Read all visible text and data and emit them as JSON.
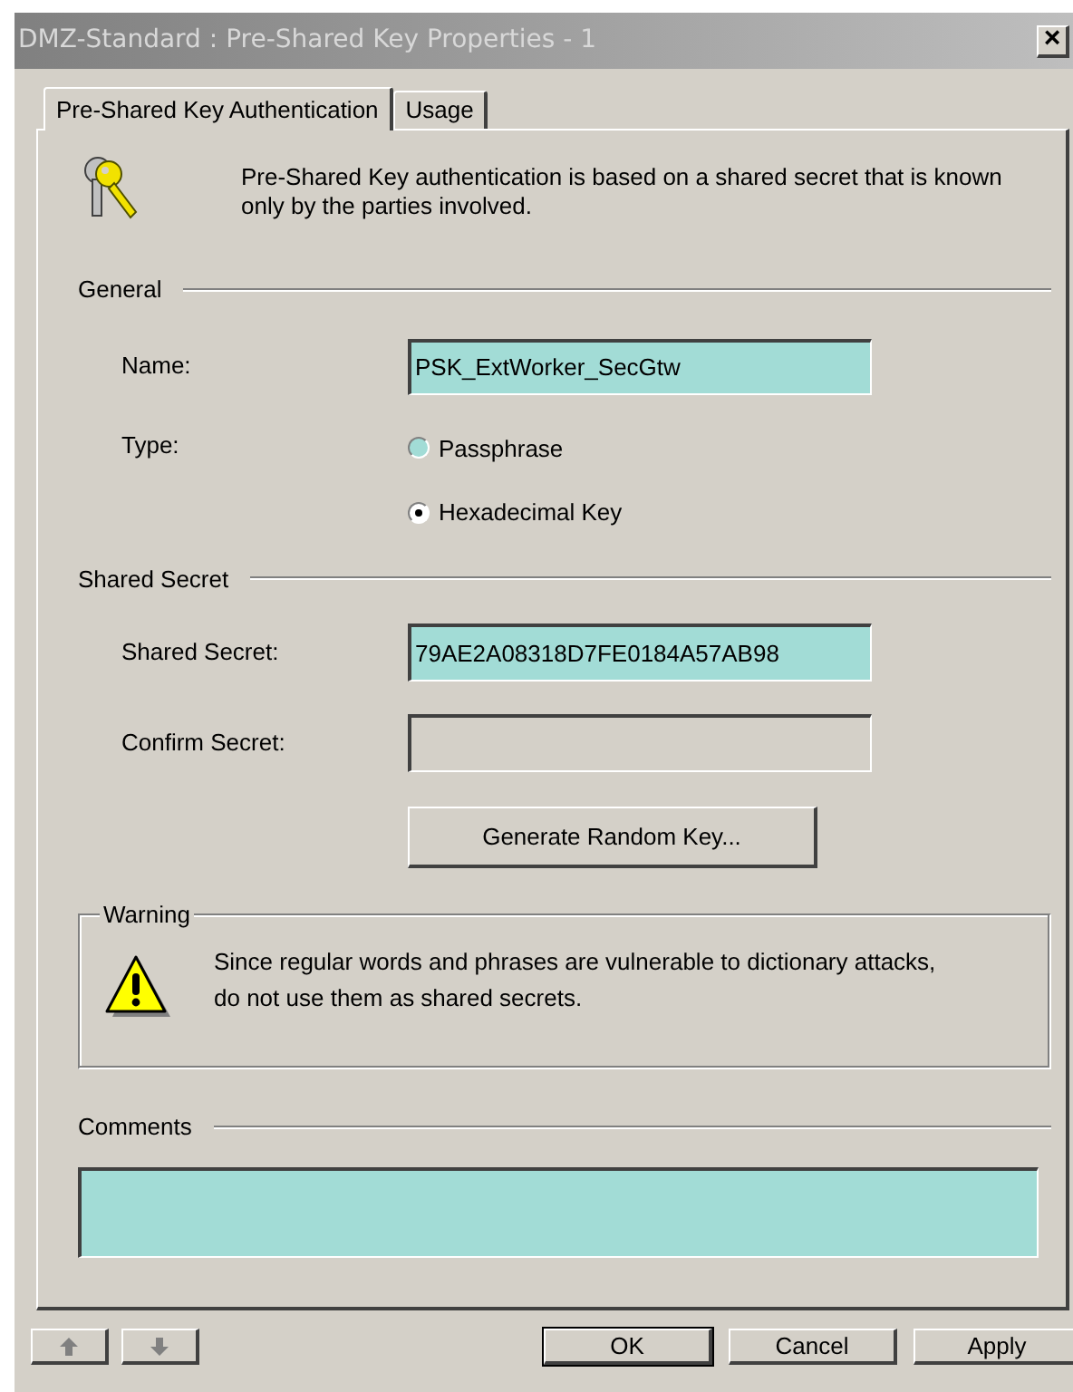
{
  "window": {
    "title": "DMZ-Standard : Pre-Shared Key Properties - 1",
    "close": "×"
  },
  "tabs": [
    {
      "label": "Pre-Shared Key Authentication",
      "selected": true
    },
    {
      "label": "Usage",
      "selected": false
    }
  ],
  "description": "Pre-Shared Key authentication is based on a shared secret that is known only by the parties involved.",
  "general": {
    "heading": "General",
    "name_label": "Name:",
    "name_value": "PSK_ExtWorker_SecGtw",
    "type_label": "Type:",
    "type_options": [
      {
        "label": "Passphrase",
        "selected": false
      },
      {
        "label": "Hexadecimal Key",
        "selected": true
      }
    ]
  },
  "shared_secret": {
    "heading": "Shared Secret",
    "secret_label": "Shared Secret:",
    "secret_value": "79AE2A08318D7FE0184A57AB98",
    "confirm_label": "Confirm Secret:",
    "generate_button": "Generate Random Key..."
  },
  "warning": {
    "heading": "Warning",
    "text": "Since regular words and phrases are vulnerable to dictionary attacks, do not use them as shared secrets."
  },
  "comments": {
    "heading": "Comments"
  },
  "buttons": [
    "OK",
    "Cancel",
    "Apply"
  ]
}
